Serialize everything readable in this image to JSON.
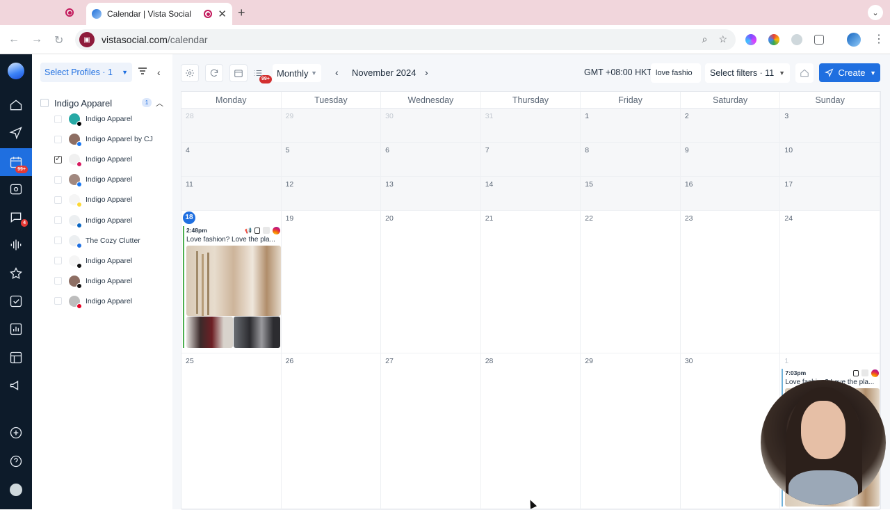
{
  "browser": {
    "tab_title": "Calendar | Vista Social",
    "url_domain": "vistasocial.com",
    "url_path": "/calendar"
  },
  "nav": {
    "calendar_badge": "99+",
    "inbox_badge": "4"
  },
  "profiles_panel": {
    "select_label": "Select Profiles · 1",
    "group_name": "Indigo Apparel",
    "group_count": "1",
    "items": [
      {
        "name": "Indigo Apparel",
        "network_color": "#000000",
        "avatar_color": "#27a9a5",
        "checked": false
      },
      {
        "name": "Indigo Apparel by CJ",
        "network_color": "#1877f2",
        "avatar_color": "#8d6e63",
        "checked": false
      },
      {
        "name": "Indigo Apparel",
        "network_color": "#d81b60",
        "avatar_color": "#f0f0f0",
        "checked": true
      },
      {
        "name": "Indigo Apparel",
        "network_color": "#1877f2",
        "avatar_color": "#a1887f",
        "checked": false
      },
      {
        "name": "Indigo Apparel",
        "network_color": "#fdd835",
        "avatar_color": "#f5f5f5",
        "checked": false
      },
      {
        "name": "Indigo Apparel",
        "network_color": "#0a66c2",
        "avatar_color": "#eceff1",
        "checked": false
      },
      {
        "name": "The Cozy Clutter",
        "network_color": "#1f6fe0",
        "avatar_color": "#eceff1",
        "checked": false
      },
      {
        "name": "Indigo Apparel",
        "network_color": "#111111",
        "avatar_color": "#f5f5f5",
        "checked": false
      },
      {
        "name": "Indigo Apparel",
        "network_color": "#111111",
        "avatar_color": "#8d6e63",
        "checked": false
      },
      {
        "name": "Indigo Apparel",
        "network_color": "#e60023",
        "avatar_color": "#bdbdbd",
        "checked": false
      }
    ]
  },
  "toolbar": {
    "list_badge": "99+",
    "view": "Monthly",
    "month": "November 2024",
    "timezone": "GMT +08:00 HKT",
    "search_value": "love fashio",
    "filters_label": "Select filters · 11",
    "create_label": "Create"
  },
  "calendar": {
    "days_of_week": [
      "Monday",
      "Tuesday",
      "Wednesday",
      "Thursday",
      "Friday",
      "Saturday",
      "Sunday"
    ],
    "weeks": [
      [
        "28",
        "29",
        "30",
        "31",
        "1",
        "2",
        "3"
      ],
      [
        "4",
        "5",
        "6",
        "7",
        "8",
        "9",
        "10"
      ],
      [
        "11",
        "12",
        "13",
        "14",
        "15",
        "16",
        "17"
      ],
      [
        "18",
        "19",
        "20",
        "21",
        "22",
        "23",
        "24"
      ],
      [
        "25",
        "26",
        "27",
        "28",
        "29",
        "30",
        "1"
      ]
    ],
    "today": "18",
    "posts": {
      "mon18": {
        "time": "2:48pm",
        "text": "Love fashion? Love the pla..."
      },
      "sun1": {
        "time": "7:03pm",
        "text": "Love fashion? Love the pla..."
      }
    }
  }
}
